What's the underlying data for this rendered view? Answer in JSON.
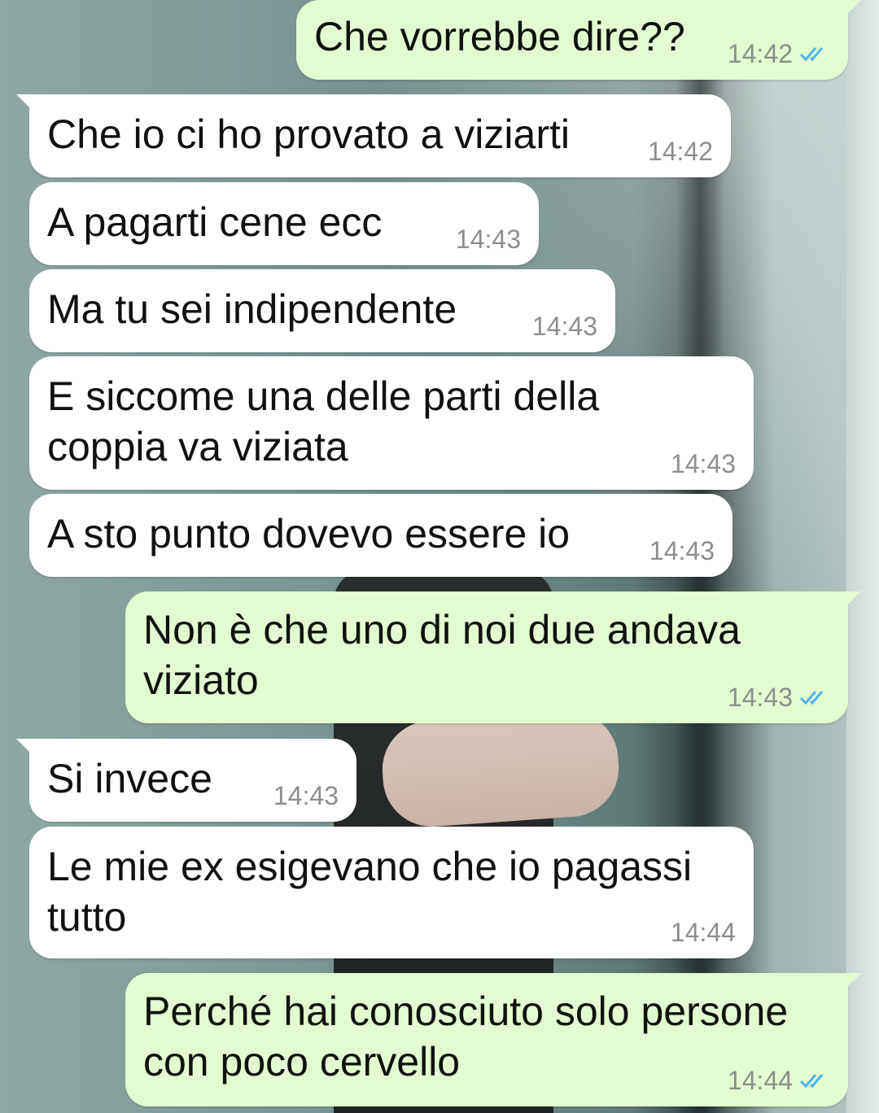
{
  "messages": [
    {
      "text": "Che vorrebbe dire??",
      "time": "14:42",
      "direction": "out",
      "status": "read"
    },
    {
      "text": "Che io ci ho provato a viziarti",
      "time": "14:42",
      "direction": "in"
    },
    {
      "text": "A pagarti cene ecc",
      "time": "14:43",
      "direction": "in"
    },
    {
      "text": "Ma tu sei indipendente",
      "time": "14:43",
      "direction": "in"
    },
    {
      "text": "E siccome una delle parti della\ncoppia va viziata",
      "time": "14:43",
      "direction": "in"
    },
    {
      "text": "A sto punto dovevo essere io",
      "time": "14:43",
      "direction": "in"
    },
    {
      "text": "Non è che uno di noi due andava\nviziato",
      "time": "14:43",
      "direction": "out",
      "status": "read"
    },
    {
      "text": "Si invece",
      "time": "14:43",
      "direction": "in"
    },
    {
      "text": "Le mie ex esigevano che io pagassi\ntutto",
      "time": "14:44",
      "direction": "in"
    },
    {
      "text": "Perché hai conosciuto solo persone\ncon poco cervello",
      "time": "14:44",
      "direction": "out",
      "status": "read"
    }
  ],
  "icons": {
    "read_receipt": "double-check-icon"
  },
  "colors": {
    "incoming_bubble": "#ffffff",
    "outgoing_bubble": "#e2fbd0",
    "timestamp": "#8b8f8e",
    "read_tick": "#4fb6ec"
  }
}
